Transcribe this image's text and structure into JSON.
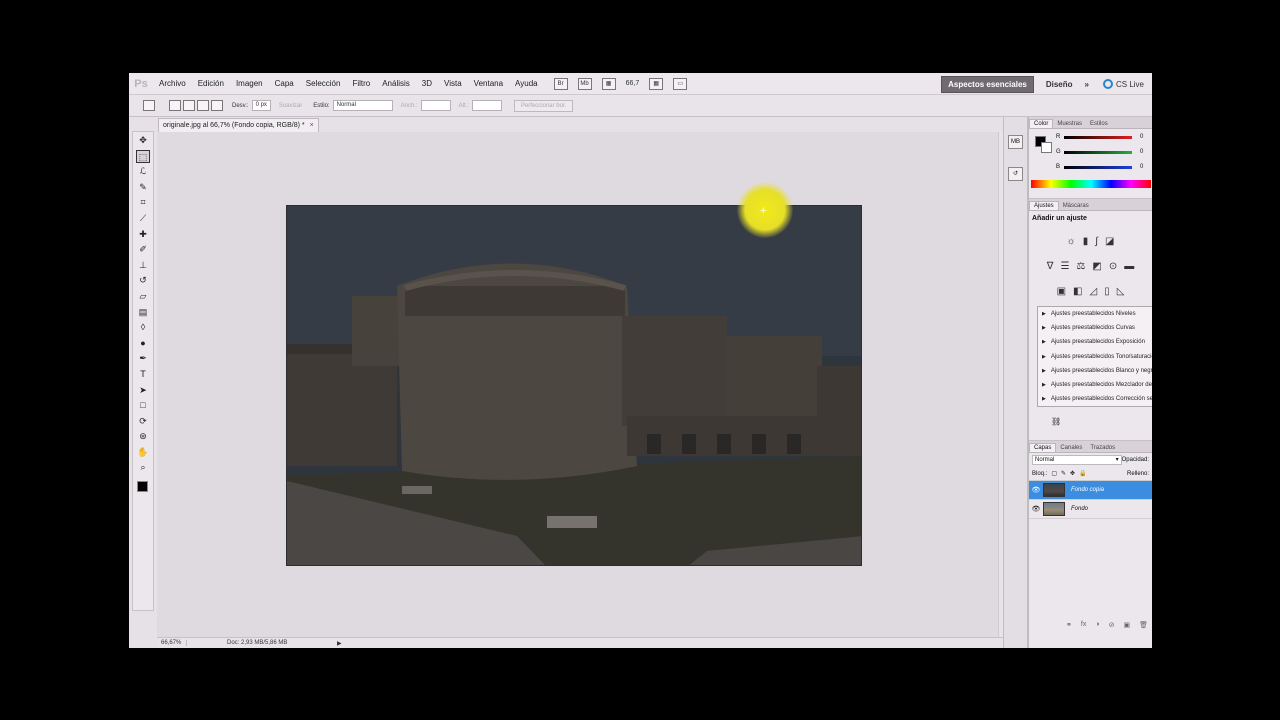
{
  "app_logo": "Ps",
  "menu": [
    "Archivo",
    "Edición",
    "Imagen",
    "Capa",
    "Selección",
    "Filtro",
    "Análisis",
    "3D",
    "Vista",
    "Ventana",
    "Ayuda"
  ],
  "menubar_tools": {
    "br_label": "Br",
    "mb_label": "Mb",
    "zoom": "66,7"
  },
  "workspaces": {
    "active": "Aspectos esenciales",
    "other": "Diseño",
    "more": "»",
    "cs_live": "CS Live"
  },
  "options": {
    "feather_label": "Desv.:",
    "feather_value": "0 px",
    "antialias_label": "Suavizar",
    "style_label": "Estilo:",
    "style_value": "Normal",
    "width_label": "Anch.:",
    "height_label": "Alt.:",
    "refine_button": "Perfeccionar bor."
  },
  "document": {
    "tab_title": "originale.jpg al 66,7% (Fondo copia, RGB/8) *",
    "close": "×"
  },
  "tools": [
    {
      "name": "move-tool",
      "glyph": "✥"
    },
    {
      "name": "rectangular-marquee-tool",
      "glyph": "⬚",
      "active": true
    },
    {
      "name": "lasso-tool",
      "glyph": "ℒ"
    },
    {
      "name": "quick-selection-tool",
      "glyph": "✎"
    },
    {
      "name": "crop-tool",
      "glyph": "⌗"
    },
    {
      "name": "eyedropper-tool",
      "glyph": "⟋"
    },
    {
      "name": "healing-brush-tool",
      "glyph": "✚"
    },
    {
      "name": "brush-tool",
      "glyph": "✐"
    },
    {
      "name": "clone-stamp-tool",
      "glyph": "⊥"
    },
    {
      "name": "history-brush-tool",
      "glyph": "↺"
    },
    {
      "name": "eraser-tool",
      "glyph": "▱"
    },
    {
      "name": "gradient-tool",
      "glyph": "▤"
    },
    {
      "name": "blur-tool",
      "glyph": "◊"
    },
    {
      "name": "dodge-tool",
      "glyph": "●"
    },
    {
      "name": "pen-tool",
      "glyph": "✒"
    },
    {
      "name": "type-tool",
      "glyph": "T"
    },
    {
      "name": "path-selection-tool",
      "glyph": "➤"
    },
    {
      "name": "rectangle-tool",
      "glyph": "□"
    },
    {
      "name": "3d-rotate-tool",
      "glyph": "⟳"
    },
    {
      "name": "3d-orbit-tool",
      "glyph": "⊛"
    },
    {
      "name": "hand-tool",
      "glyph": "✋"
    },
    {
      "name": "zoom-tool",
      "glyph": "⌕"
    }
  ],
  "status": {
    "zoom": "66,67%",
    "doc": "Doc: 2,93 MB/5,86 MB",
    "arrow": "▶"
  },
  "color_panel": {
    "tabs": [
      "Color",
      "Muestras",
      "Estilos"
    ],
    "channels": [
      {
        "label": "R",
        "value": "0",
        "color": "#e02020"
      },
      {
        "label": "G",
        "value": "0",
        "color": "#20b040"
      },
      {
        "label": "B",
        "value": "0",
        "color": "#2040e0"
      }
    ]
  },
  "adjustments_panel": {
    "tabs": [
      "Ajustes",
      "Máscaras"
    ],
    "title": "Añadir un ajuste",
    "icon_rows": [
      [
        "☼",
        "▮",
        "∫",
        "◪"
      ],
      [
        "∇",
        "☰",
        "⚖",
        "◩",
        "⊙",
        "▬"
      ],
      [
        "▣",
        "◧",
        "◿",
        "▯",
        "◺"
      ]
    ],
    "presets": [
      "Ajustes preestablecidos Niveles",
      "Ajustes preestablecidos Curvas",
      "Ajustes preestablecidos Exposición",
      "Ajustes preestablecidos Tono/saturación",
      "Ajustes preestablecidos Blanco y negro",
      "Ajustes preestablecidos Mezclador de canales",
      "Ajustes preestablecidos Corrección selectiva"
    ]
  },
  "layers_panel": {
    "tabs": [
      "Capas",
      "Canales",
      "Trazados"
    ],
    "blend_mode": "Normal",
    "opacity_label": "Opacidad:",
    "lock_label": "Bloq.:",
    "fill_label": "Relleno:",
    "layers": [
      {
        "name": "Fondo copia",
        "selected": true
      },
      {
        "name": "Fondo",
        "selected": false
      }
    ],
    "footer_icons": [
      "⚭",
      "fx",
      "◑",
      "⊘",
      "▣",
      "🗑"
    ]
  }
}
